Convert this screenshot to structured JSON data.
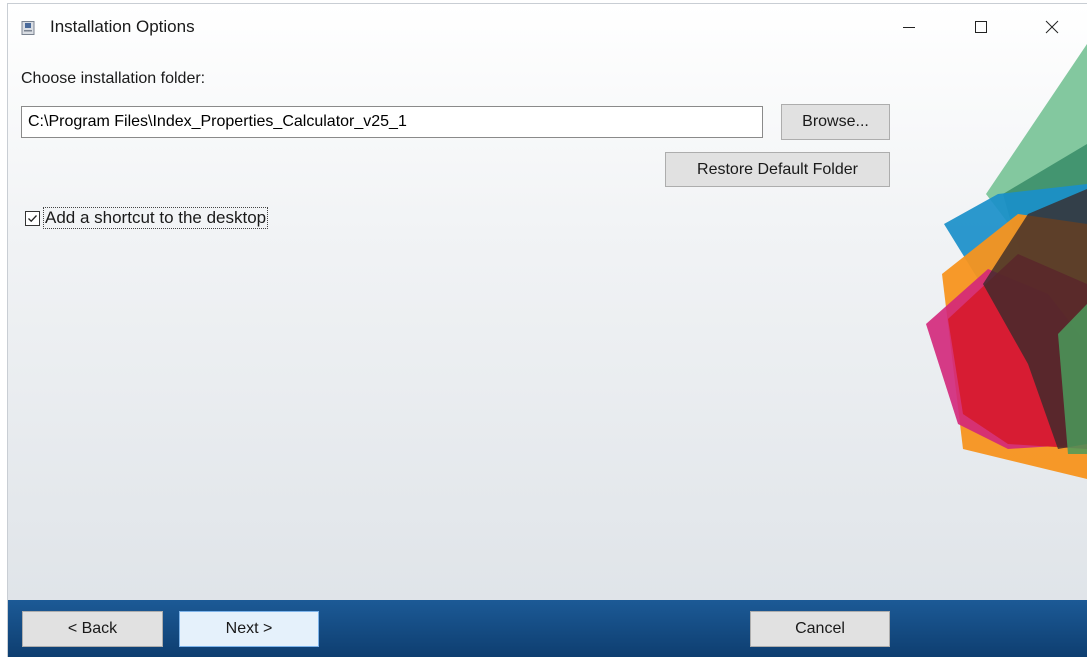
{
  "window": {
    "title": "Installation Options",
    "icon": "installer-app-icon",
    "controls": {
      "minimize_icon": "minimize-icon",
      "maximize_icon": "maximize-icon",
      "close_icon": "close-icon"
    }
  },
  "main": {
    "folder_label": "Choose installation folder:",
    "folder_path": "C:\\Program Files\\Index_Properties_Calculator_v25_1",
    "browse_label": "Browse...",
    "restore_label": "Restore Default Folder",
    "shortcut_label": "Add a shortcut to the desktop",
    "shortcut_checked": true
  },
  "footer": {
    "back_label": "< Back",
    "next_label": "Next >",
    "cancel_label": "Cancel"
  },
  "colors": {
    "footer_blue": "#1c5a96",
    "art_green": "#7cc59a",
    "art_blue": "#1a8fc9",
    "art_orange": "#f7931e",
    "art_red": "#d7192a",
    "art_magenta": "#d3267a",
    "art_dark": "#3a2a2a"
  }
}
